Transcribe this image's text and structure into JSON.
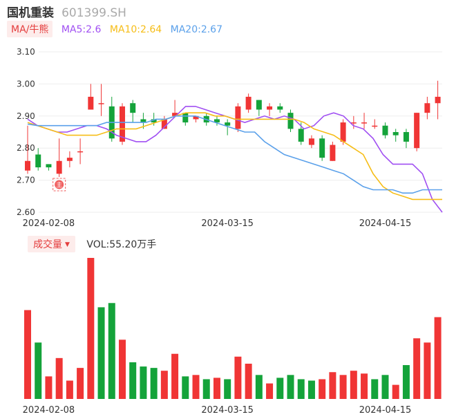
{
  "header": {
    "name": "国机重装",
    "code": "601399.SH"
  },
  "ma_legend": {
    "button": "MA/牛熊",
    "ma5": "MA5:2.6",
    "ma10": "MA10:2.64",
    "ma20": "MA20:2.67"
  },
  "volume_legend": {
    "button": "成交量",
    "value": "VOL:55.20万手"
  },
  "colors": {
    "up": "#f03535",
    "down": "#14a33a",
    "ma5": "#a04ff2",
    "ma10": "#f6bd16",
    "ma20": "#5aa0ea",
    "grid": "#eeeeee",
    "tick": "#333333"
  },
  "chart_data": [
    {
      "type": "candlestick",
      "title": "",
      "y_ticks": [
        "3.10",
        "3.00",
        "2.90",
        "2.80",
        "2.70",
        "2.60"
      ],
      "ylim": [
        2.6,
        3.1
      ],
      "x_tick_labels": [
        {
          "index": 2,
          "label": "2024-02-08"
        },
        {
          "index": 19,
          "label": "2024-03-15"
        },
        {
          "index": 34,
          "label": "2024-04-15"
        }
      ],
      "marker": {
        "index": 3,
        "label": "主"
      },
      "candles": [
        {
          "o": 2.73,
          "c": 2.76,
          "h": 2.87,
          "l": 2.72
        },
        {
          "o": 2.78,
          "c": 2.74,
          "h": 2.8,
          "l": 2.73
        },
        {
          "o": 2.75,
          "c": 2.74,
          "h": 2.75,
          "l": 2.73
        },
        {
          "o": 2.72,
          "c": 2.76,
          "h": 2.83,
          "l": 2.71
        },
        {
          "o": 2.76,
          "c": 2.77,
          "h": 2.79,
          "l": 2.74
        },
        {
          "o": 2.79,
          "c": 2.79,
          "h": 2.83,
          "l": 2.75
        },
        {
          "o": 2.92,
          "c": 2.96,
          "h": 3.0,
          "l": 2.92
        },
        {
          "o": 2.94,
          "c": 2.94,
          "h": 3.0,
          "l": 2.9
        },
        {
          "o": 2.93,
          "c": 2.83,
          "h": 2.96,
          "l": 2.82
        },
        {
          "o": 2.82,
          "c": 2.93,
          "h": 2.94,
          "l": 2.81
        },
        {
          "o": 2.94,
          "c": 2.91,
          "h": 2.95,
          "l": 2.88
        },
        {
          "o": 2.89,
          "c": 2.88,
          "h": 2.91,
          "l": 2.86
        },
        {
          "o": 2.89,
          "c": 2.88,
          "h": 2.91,
          "l": 2.87
        },
        {
          "o": 2.86,
          "c": 2.89,
          "h": 2.9,
          "l": 2.86
        },
        {
          "o": 2.9,
          "c": 2.91,
          "h": 2.95,
          "l": 2.9
        },
        {
          "o": 2.91,
          "c": 2.88,
          "h": 2.91,
          "l": 2.87
        },
        {
          "o": 2.89,
          "c": 2.9,
          "h": 2.9,
          "l": 2.88
        },
        {
          "o": 2.9,
          "c": 2.88,
          "h": 2.91,
          "l": 2.87
        },
        {
          "o": 2.89,
          "c": 2.88,
          "h": 2.9,
          "l": 2.87
        },
        {
          "o": 2.88,
          "c": 2.87,
          "h": 2.89,
          "l": 2.84
        },
        {
          "o": 2.86,
          "c": 2.93,
          "h": 2.94,
          "l": 2.85
        },
        {
          "o": 2.92,
          "c": 2.96,
          "h": 2.97,
          "l": 2.91
        },
        {
          "o": 2.95,
          "c": 2.92,
          "h": 2.95,
          "l": 2.9
        },
        {
          "o": 2.92,
          "c": 2.93,
          "h": 2.94,
          "l": 2.9
        },
        {
          "o": 2.93,
          "c": 2.92,
          "h": 2.94,
          "l": 2.91
        },
        {
          "o": 2.91,
          "c": 2.86,
          "h": 2.92,
          "l": 2.85
        },
        {
          "o": 2.86,
          "c": 2.82,
          "h": 2.88,
          "l": 2.81
        },
        {
          "o": 2.81,
          "c": 2.83,
          "h": 2.84,
          "l": 2.8
        },
        {
          "o": 2.83,
          "c": 2.77,
          "h": 2.84,
          "l": 2.76
        },
        {
          "o": 2.76,
          "c": 2.81,
          "h": 2.82,
          "l": 2.76
        },
        {
          "o": 2.82,
          "c": 2.88,
          "h": 2.89,
          "l": 2.81
        },
        {
          "o": 2.88,
          "c": 2.88,
          "h": 2.9,
          "l": 2.86
        },
        {
          "o": 2.88,
          "c": 2.88,
          "h": 2.91,
          "l": 2.86
        },
        {
          "o": 2.87,
          "c": 2.87,
          "h": 2.89,
          "l": 2.86
        },
        {
          "o": 2.87,
          "c": 2.84,
          "h": 2.88,
          "l": 2.83
        },
        {
          "o": 2.85,
          "c": 2.84,
          "h": 2.86,
          "l": 2.82
        },
        {
          "o": 2.85,
          "c": 2.82,
          "h": 2.86,
          "l": 2.8
        },
        {
          "o": 2.8,
          "c": 2.91,
          "h": 2.91,
          "l": 2.79
        },
        {
          "o": 2.91,
          "c": 2.94,
          "h": 2.96,
          "l": 2.89
        },
        {
          "o": 2.94,
          "c": 2.96,
          "h": 3.01,
          "l": 2.89
        }
      ],
      "series": [
        {
          "name": "MA5",
          "values": [
            2.89,
            2.87,
            2.86,
            2.85,
            2.85,
            2.86,
            2.87,
            2.87,
            2.86,
            2.84,
            2.83,
            2.82,
            2.82,
            2.84,
            2.87,
            2.9,
            2.93,
            2.93,
            2.92,
            2.91,
            2.9,
            2.89,
            2.88,
            2.89,
            2.9,
            2.89,
            2.9,
            2.89,
            2.86,
            2.87,
            2.9,
            2.91,
            2.9,
            2.87,
            2.86,
            2.83,
            2.78,
            2.75,
            2.75,
            2.75,
            2.72,
            2.64,
            2.6
          ]
        },
        {
          "name": "MA10",
          "values": [
            2.88,
            2.87,
            2.86,
            2.85,
            2.84,
            2.84,
            2.84,
            2.84,
            2.85,
            2.86,
            2.86,
            2.86,
            2.87,
            2.88,
            2.89,
            2.9,
            2.91,
            2.91,
            2.91,
            2.9,
            2.9,
            2.89,
            2.89,
            2.89,
            2.89,
            2.89,
            2.89,
            2.89,
            2.88,
            2.86,
            2.85,
            2.84,
            2.82,
            2.8,
            2.78,
            2.72,
            2.68,
            2.66,
            2.65,
            2.64,
            2.64,
            2.64,
            2.64
          ]
        },
        {
          "name": "MA20",
          "values": [
            2.875,
            2.87,
            2.87,
            2.87,
            2.87,
            2.87,
            2.87,
            2.87,
            2.88,
            2.88,
            2.88,
            2.88,
            2.88,
            2.89,
            2.89,
            2.9,
            2.9,
            2.9,
            2.89,
            2.88,
            2.87,
            2.86,
            2.85,
            2.85,
            2.82,
            2.8,
            2.78,
            2.77,
            2.76,
            2.75,
            2.74,
            2.73,
            2.72,
            2.7,
            2.68,
            2.67,
            2.67,
            2.67,
            2.66,
            2.66,
            2.67,
            2.67,
            2.67
          ]
        }
      ]
    },
    {
      "type": "bar",
      "title": "",
      "ylim": [
        0,
        100
      ],
      "x_tick_labels": [
        {
          "index": 2,
          "label": "2024-02-08"
        },
        {
          "index": 19,
          "label": "2024-03-15"
        },
        {
          "index": 34,
          "label": "2024-04-15"
        }
      ],
      "values": [
        63,
        40,
        16,
        29,
        13,
        22,
        100,
        65,
        68,
        42,
        26,
        23,
        22,
        20,
        32,
        16,
        17,
        14,
        15,
        14,
        30,
        25,
        17,
        11,
        15,
        17,
        14,
        13,
        14,
        19,
        17,
        20,
        18,
        14,
        17,
        10,
        24,
        43,
        40,
        58
      ],
      "directions": [
        "up",
        "down",
        "up",
        "up",
        "up",
        "up",
        "up",
        "down",
        "down",
        "up",
        "down",
        "down",
        "down",
        "up",
        "up",
        "down",
        "up",
        "down",
        "up",
        "down",
        "up",
        "up",
        "down",
        "up",
        "down",
        "down",
        "down",
        "down",
        "up",
        "up",
        "up",
        "up",
        "up",
        "down",
        "down",
        "up",
        "down",
        "up",
        "up",
        "up"
      ]
    }
  ]
}
